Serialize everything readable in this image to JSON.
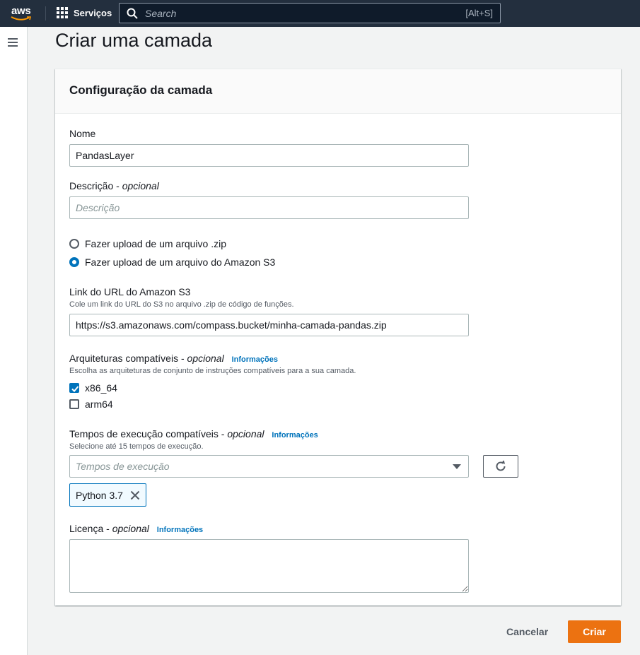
{
  "topnav": {
    "logo_text": "aws",
    "services_label": "Serviços",
    "search_placeholder": "Search",
    "search_shortcut": "[Alt+S]"
  },
  "page": {
    "title": "Criar uma camada"
  },
  "container": {
    "header": "Configuração da camada"
  },
  "form": {
    "name": {
      "label": "Nome",
      "value": "PandasLayer"
    },
    "description": {
      "label": "Descrição",
      "optional": "opcional",
      "placeholder": "Descrição",
      "value": ""
    },
    "upload_options": [
      {
        "label": "Fazer upload de um arquivo .zip",
        "checked": false
      },
      {
        "label": "Fazer upload de um arquivo do Amazon S3",
        "checked": true
      }
    ],
    "s3_link": {
      "label": "Link do URL do Amazon S3",
      "description": "Cole um link do URL do S3 no arquivo .zip de código de funções.",
      "value": "https://s3.amazonaws.com/compass.bucket/minha-camada-pandas.zip"
    },
    "architectures": {
      "label": "Arquiteturas compatíveis",
      "optional": "opcional",
      "info": "Informações",
      "description": "Escolha as arquiteturas de conjunto de instruções compatíveis para a sua camada.",
      "options": [
        {
          "label": "x86_64",
          "checked": true
        },
        {
          "label": "arm64",
          "checked": false
        }
      ]
    },
    "runtimes": {
      "label": "Tempos de execução compatíveis",
      "optional": "opcional",
      "info": "Informações",
      "description": "Selecione até 15 tempos de execução.",
      "placeholder": "Tempos de execução",
      "selected_tokens": [
        "Python 3.7"
      ]
    },
    "license": {
      "label": "Licença",
      "optional": "opcional",
      "info": "Informações",
      "value": ""
    }
  },
  "actions": {
    "cancel": "Cancelar",
    "create": "Criar"
  },
  "colors": {
    "nav_bg": "#232f3e",
    "primary": "#ec7211",
    "link": "#0073bb"
  }
}
